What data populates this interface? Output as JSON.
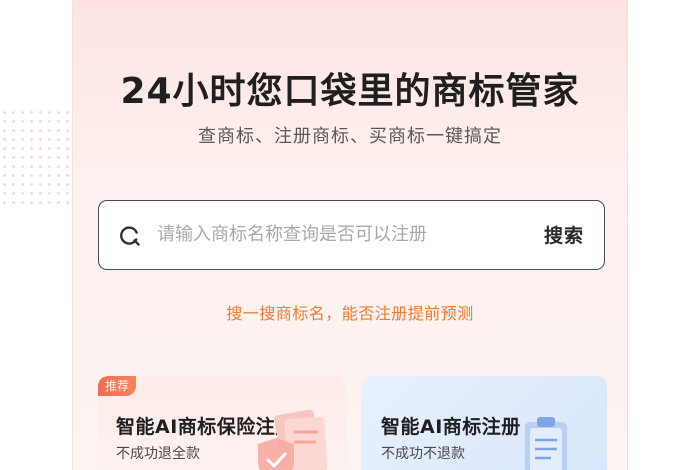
{
  "hero": {
    "headline": "24小时您口袋里的商标管家",
    "subline": "查商标、注册商标、买商标一键搞定"
  },
  "search": {
    "placeholder": "请输入商标名称查询是否可以注册",
    "value": "",
    "button_label": "搜索",
    "icon": "search-icon"
  },
  "tip": "搜一搜商标名，能否注册提前预测",
  "cards": [
    {
      "badge": "推荐",
      "title": "智能AI商标保险注册",
      "desc": "不成功退全款",
      "icon": "insurance-shield-icon"
    },
    {
      "title": "智能AI商标注册",
      "desc": "不成功不退款",
      "icon": "clipboard-icon"
    }
  ],
  "colors": {
    "accent": "#ef7a2e",
    "badge": "#f36c50",
    "card_left_bg": "#fdebe9",
    "card_right_bg": "#e8f1fd"
  }
}
